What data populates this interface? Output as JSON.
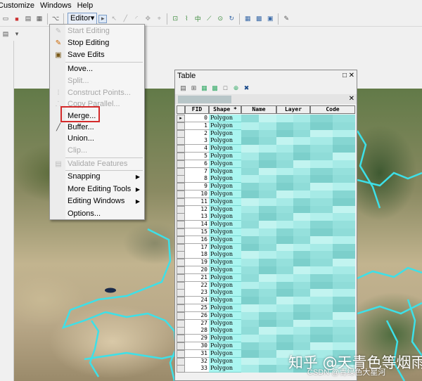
{
  "menubar": {
    "items": [
      "Customize",
      "Windows",
      "Help"
    ]
  },
  "toolbar": {
    "editor_label": "Editor",
    "editor_arrow": "▾"
  },
  "editor_menu": {
    "items": [
      {
        "label": "Start Editing",
        "disabled": true,
        "icon": "start-editing-icon"
      },
      {
        "label": "Stop Editing",
        "disabled": false,
        "icon": "stop-editing-icon"
      },
      {
        "label": "Save Edits",
        "disabled": false,
        "icon": "save-edits-icon"
      },
      {
        "label": "Move...",
        "disabled": false,
        "icon": ""
      },
      {
        "label": "Split...",
        "disabled": true,
        "icon": ""
      },
      {
        "label": "Construct Points...",
        "disabled": true,
        "icon": "construct-points-icon"
      },
      {
        "label": "Copy Parallel...",
        "disabled": true,
        "icon": "copy-parallel-icon"
      },
      {
        "label": "Merge...",
        "disabled": false,
        "icon": ""
      },
      {
        "label": "Buffer...",
        "disabled": false,
        "icon": "buffer-icon"
      },
      {
        "label": "Union...",
        "disabled": false,
        "icon": ""
      },
      {
        "label": "Clip...",
        "disabled": true,
        "icon": ""
      },
      {
        "label": "Validate Features",
        "disabled": true,
        "icon": "validate-features-icon"
      },
      {
        "label": "Snapping",
        "disabled": false,
        "icon": "",
        "submenu": true
      },
      {
        "label": "More Editing Tools",
        "disabled": false,
        "icon": "",
        "submenu": true
      },
      {
        "label": "Editing Windows",
        "disabled": false,
        "icon": "",
        "submenu": true
      },
      {
        "label": "Options...",
        "disabled": false,
        "icon": ""
      }
    ],
    "highlighted": "Merge..."
  },
  "table_window": {
    "title": "Table",
    "columns": [
      "FID",
      "Shape *",
      "Name",
      "Layer",
      "Code"
    ],
    "rows": [
      {
        "fid": "0",
        "shape": "Polygon"
      },
      {
        "fid": "1",
        "shape": "Polygon"
      },
      {
        "fid": "2",
        "shape": "Polygon"
      },
      {
        "fid": "3",
        "shape": "Polygon"
      },
      {
        "fid": "4",
        "shape": "Polygon"
      },
      {
        "fid": "5",
        "shape": "Polygon"
      },
      {
        "fid": "6",
        "shape": "Polygon"
      },
      {
        "fid": "7",
        "shape": "Polygon"
      },
      {
        "fid": "8",
        "shape": "Polygon"
      },
      {
        "fid": "9",
        "shape": "Polygon"
      },
      {
        "fid": "10",
        "shape": "Polygon"
      },
      {
        "fid": "11",
        "shape": "Polygon"
      },
      {
        "fid": "12",
        "shape": "Polygon"
      },
      {
        "fid": "13",
        "shape": "Polygon"
      },
      {
        "fid": "14",
        "shape": "Polygon"
      },
      {
        "fid": "15",
        "shape": "Polygon"
      },
      {
        "fid": "16",
        "shape": "Polygon"
      },
      {
        "fid": "17",
        "shape": "Polygon"
      },
      {
        "fid": "18",
        "shape": "Polygon"
      },
      {
        "fid": "19",
        "shape": "Polygon"
      },
      {
        "fid": "20",
        "shape": "Polygon"
      },
      {
        "fid": "21",
        "shape": "Polygon"
      },
      {
        "fid": "22",
        "shape": "Polygon"
      },
      {
        "fid": "23",
        "shape": "Polygon"
      },
      {
        "fid": "24",
        "shape": "Polygon"
      },
      {
        "fid": "25",
        "shape": "Polygon"
      },
      {
        "fid": "26",
        "shape": "Polygon"
      },
      {
        "fid": "27",
        "shape": "Polygon"
      },
      {
        "fid": "28",
        "shape": "Polygon"
      },
      {
        "fid": "29",
        "shape": "Polygon"
      },
      {
        "fid": "30",
        "shape": "Polygon"
      },
      {
        "fid": "31",
        "shape": "Polygon"
      },
      {
        "fid": "32",
        "shape": "Polygon"
      },
      {
        "fid": "33",
        "shape": "Polygon"
      }
    ]
  },
  "watermark": {
    "main": "知乎 @天青色等烟雨",
    "csdn": "CSDN @青绿色大星河"
  },
  "colors": {
    "highlight_box": "#d42a2a",
    "shape_cell": "#aaf5f0",
    "boundary": "#3de0e8"
  }
}
